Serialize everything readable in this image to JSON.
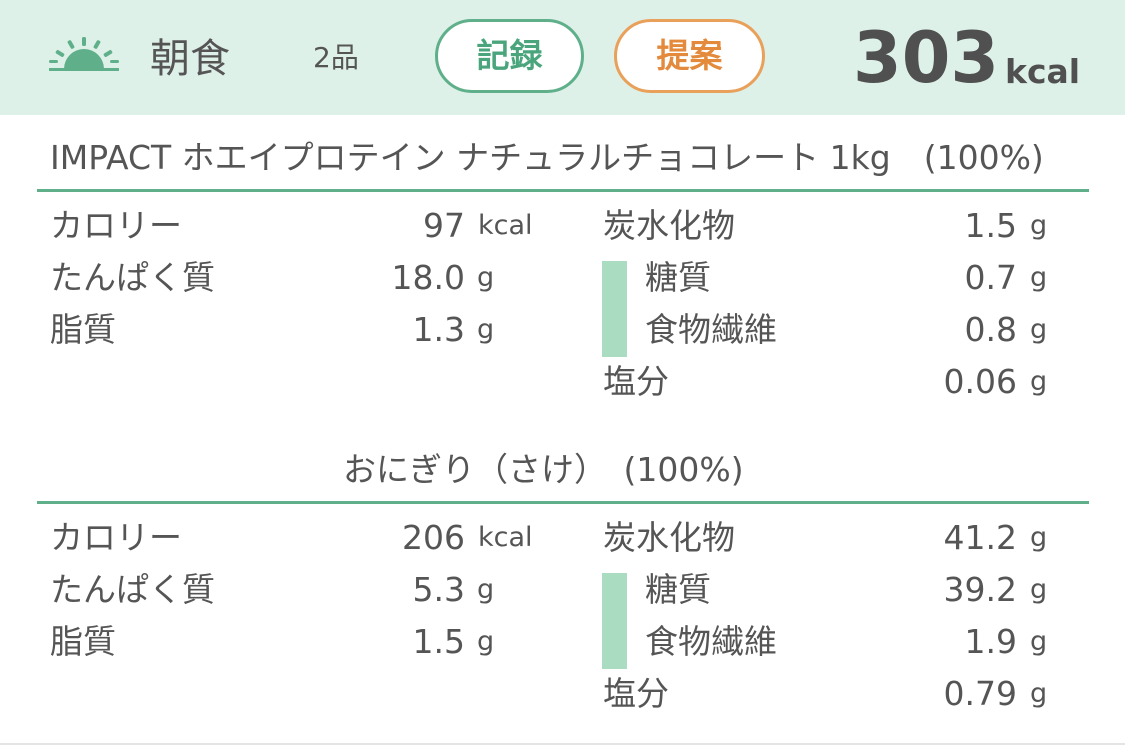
{
  "header": {
    "meal": "朝食",
    "count": "2品",
    "record_label": "記録",
    "suggest_label": "提案",
    "total_kcal": "303",
    "total_unit": "kcal",
    "icon": "sunrise-icon",
    "colors": {
      "bg": "#def1e8",
      "green": "#5fb08a",
      "orange": "#e9a05a"
    }
  },
  "items": [
    {
      "title": "IMPACT ホエイプロテイン ナチュラルチョコレート 1kg　(100%)",
      "calories": {
        "label": "カロリー",
        "value": "97",
        "unit": "kcal"
      },
      "protein": {
        "label": "たんぱく質",
        "value": "18.0",
        "unit": "g"
      },
      "fat": {
        "label": "脂質",
        "value": "1.3",
        "unit": "g"
      },
      "carbs": {
        "label": "炭水化物",
        "value": "1.5",
        "unit": "g"
      },
      "sugar": {
        "label": "糖質",
        "value": "0.7",
        "unit": "g"
      },
      "fiber": {
        "label": "食物繊維",
        "value": "0.8",
        "unit": "g"
      },
      "salt": {
        "label": "塩分",
        "value": "0.06",
        "unit": "g"
      }
    },
    {
      "title": "おにぎり（さけ）　(100%)",
      "calories": {
        "label": "カロリー",
        "value": "206",
        "unit": "kcal"
      },
      "protein": {
        "label": "たんぱく質",
        "value": "5.3",
        "unit": "g"
      },
      "fat": {
        "label": "脂質",
        "value": "1.5",
        "unit": "g"
      },
      "carbs": {
        "label": "炭水化物",
        "value": "41.2",
        "unit": "g"
      },
      "sugar": {
        "label": "糖質",
        "value": "39.2",
        "unit": "g"
      },
      "fiber": {
        "label": "食物繊維",
        "value": "1.9",
        "unit": "g"
      },
      "salt": {
        "label": "塩分",
        "value": "0.79",
        "unit": "g"
      }
    }
  ]
}
